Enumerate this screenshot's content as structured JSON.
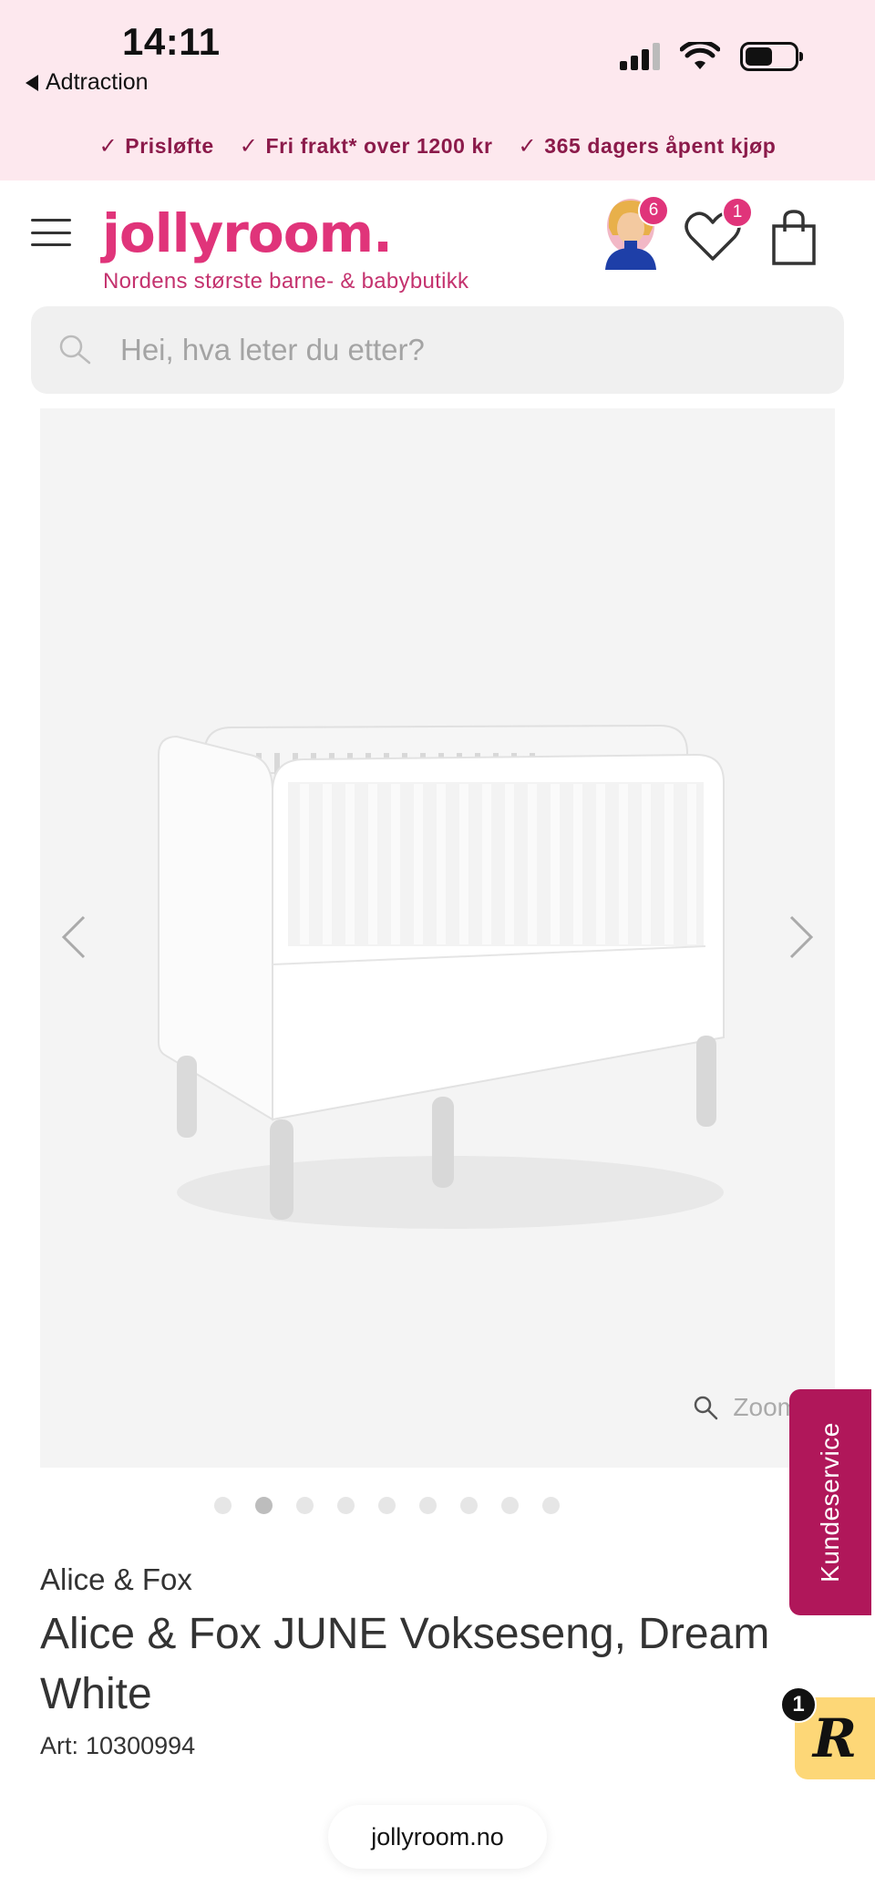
{
  "status_bar": {
    "time": "14:11",
    "back_app": "Adtraction",
    "battery_level": 0.55
  },
  "promo": {
    "items": [
      "Prisløfte",
      "Fri frakt* over 1200 kr",
      "365 dagers åpent kjøp"
    ]
  },
  "header": {
    "logo": "jollyroom.",
    "tagline": "Nordens største barne- & babybutikk",
    "avatar_badge": "6",
    "wishlist_badge": "1"
  },
  "search": {
    "placeholder": "Hei, hva leter du etter?"
  },
  "gallery": {
    "zoom_label": "Zoom",
    "image_count": 9,
    "active_index": 1
  },
  "product": {
    "brand": "Alice & Fox",
    "title": "Alice & Fox JUNE Vokseseng, Dream White",
    "art_label": "Art:",
    "art_number": "10300994"
  },
  "floating": {
    "kundeservice": "Kundeservice",
    "r_badge": "1",
    "r_label": "R"
  },
  "browser": {
    "url": "jollyroom.no"
  },
  "colors": {
    "brand_pink": "#e0347a",
    "promo_bg": "#fde8ee",
    "kundeservice_bg": "#b0175a",
    "r_button_bg": "#fdd777"
  }
}
